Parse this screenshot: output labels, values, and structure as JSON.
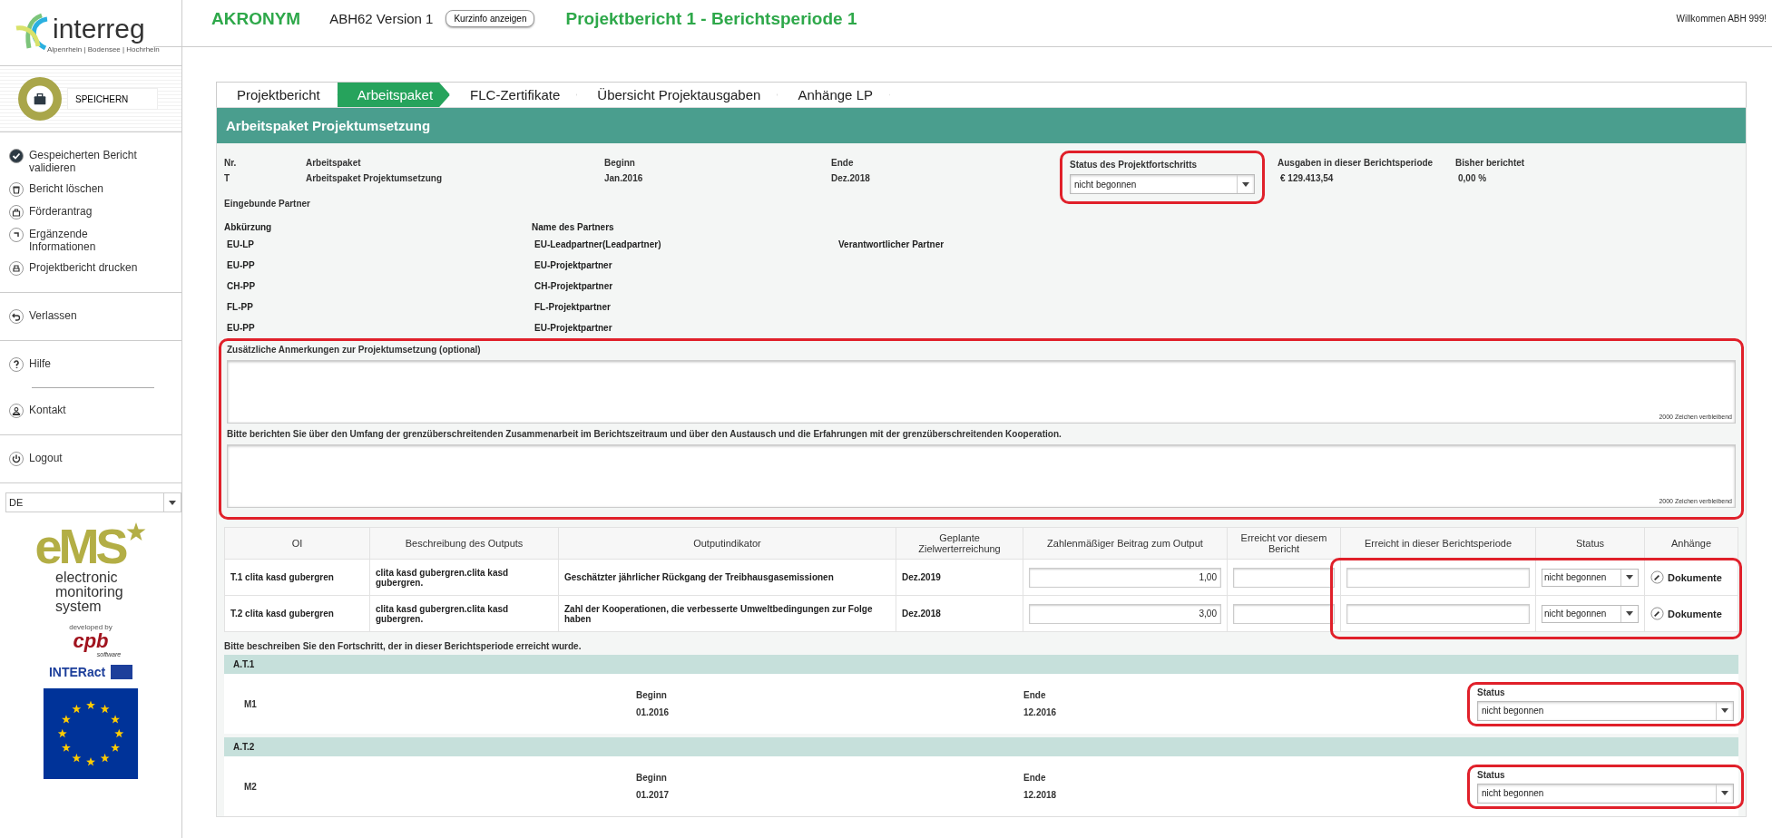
{
  "header": {
    "acronym": "AKRONYM",
    "version": "ABH62 Version 1",
    "info_button": "Kurzinfo anzeigen",
    "report_title": "Projektbericht 1 - Berichtsperiode 1",
    "welcome": "Willkommen ABH 999!"
  },
  "sidebar": {
    "logo": {
      "name": "interreg",
      "subtitle": "Alpenrhein | Bodensee | Hochrhein"
    },
    "save_button": "SPEICHERN",
    "menu_groups": [
      [
        {
          "kind": "check",
          "label": "Gespeicherten Bericht validieren"
        },
        {
          "kind": "trash",
          "label": "Bericht löschen"
        },
        {
          "kind": "bag",
          "label": "Förderantrag"
        },
        {
          "kind": "corner",
          "label": "Ergänzende Informationen"
        },
        {
          "kind": "print",
          "label": "Projektbericht drucken"
        }
      ],
      [
        {
          "kind": "back",
          "label": "Verlassen"
        }
      ],
      [
        {
          "kind": "help",
          "label": "Hilfe"
        },
        {
          "kind": "person",
          "label": "Kontakt"
        }
      ],
      [
        {
          "kind": "power",
          "label": "Logout"
        }
      ]
    ],
    "language": "DE",
    "ems_logo": {
      "mark": "eMS",
      "text": "electronic monitoring system"
    },
    "developer": {
      "caption": "developed by",
      "name": "cpb",
      "sub": "software"
    },
    "partner_logo": "INTERact"
  },
  "tabs": [
    {
      "label": "Projektbericht",
      "selected": false
    },
    {
      "label": "Arbeitspaket",
      "selected": true
    },
    {
      "label": "FLC-Zertifikate",
      "selected": false
    },
    {
      "label": "Übersicht Projektausgaben",
      "selected": false
    },
    {
      "label": "Anhänge LP",
      "selected": false
    }
  ],
  "panel_title": "Arbeitspaket Projektumsetzung",
  "work_package": {
    "nr_label": "Nr.",
    "nr": "T",
    "name_label": "Arbeitspaket",
    "name": "Arbeitspaket Projektumsetzung",
    "begin_label": "Beginn",
    "begin": "Jan.2016",
    "end_label": "Ende",
    "end": "Dez.2018",
    "status_label": "Status des Projektfortschritts",
    "status": "nicht begonnen",
    "status_highlighted": true,
    "expenses_label": "Ausgaben in dieser Berichtsperiode",
    "expenses": "€ 129.413,54",
    "reported_label": "Bisher berichtet",
    "reported": "0,00 %"
  },
  "partners": {
    "title": "Eingebunde Partner",
    "columns": [
      "Abkürzung",
      "Name des Partners"
    ],
    "rows": [
      {
        "abbr": "EU-LP",
        "name": "EU-Leadpartner(Leadpartner)",
        "role": "Verantwortlicher Partner"
      },
      {
        "abbr": "EU-PP",
        "name": "EU-Projektpartner"
      },
      {
        "abbr": "CH-PP",
        "name": "CH-Projektpartner"
      },
      {
        "abbr": "FL-PP",
        "name": "FL-Projektpartner"
      },
      {
        "abbr": "EU-PP",
        "name": "EU-Projektpartner"
      }
    ]
  },
  "comments": {
    "highlighted": true,
    "fields": [
      {
        "label": "Zusätzliche Anmerkungen zur Projektumsetzung (optional)",
        "counter": "2000 Zeichen verbleibend"
      },
      {
        "label": "Bitte berichten Sie über den Umfang der grenzüberschreitenden Zusammenarbeit im Berichtszeitraum und über den Austausch und die Erfahrungen mit der grenzüberschreitenden Kooperation.",
        "counter": "2000 Zeichen verbleibend"
      }
    ]
  },
  "outputs": {
    "highlighted": true,
    "columns": [
      "OI",
      "Beschreibung des Outputs",
      "Outputindikator",
      "Geplante Zielwerterreichung",
      "Zahlenmäßiger Beitrag zum Output",
      "Erreicht vor diesem Bericht",
      "Erreicht in dieser Berichtsperiode",
      "Status",
      "Anhänge"
    ],
    "rows": [
      {
        "oi": "T.1 clita kasd gubergren",
        "description": "clita kasd gubergren.clita kasd gubergren.",
        "indicator": "Geschätzter jährlicher Rückgang der Treibhausgasemissionen",
        "target": "Dez.2019",
        "contribution": "1,00",
        "status": "nicht begonnen",
        "attachment": "Dokumente"
      },
      {
        "oi": "T.2 clita kasd gubergren",
        "description": "clita kasd gubergren.clita kasd gubergren.",
        "indicator": "Zahl der Kooperationen, die verbesserte Umweltbedingungen zur Folge haben",
        "target": "Dez.2018",
        "contribution": "3,00",
        "status": "nicht begonnen",
        "attachment": "Dokumente"
      }
    ]
  },
  "progress_hint": "Bitte beschreiben Sie den Fortschritt, der in dieser Berichtsperiode erreicht wurde.",
  "milestones": [
    {
      "group": "A.T.1",
      "name": "M1",
      "begin_label": "Beginn",
      "begin": "01.2016",
      "end_label": "Ende",
      "end": "12.2016",
      "status_label": "Status",
      "status": "nicht begonnen",
      "highlighted": true
    },
    {
      "group": "A.T.2",
      "name": "M2",
      "begin_label": "Beginn",
      "begin": "01.2017",
      "end_label": "Ende",
      "end": "12.2018",
      "status_label": "Status",
      "status": "nicht begonnen",
      "highlighted": true
    }
  ]
}
